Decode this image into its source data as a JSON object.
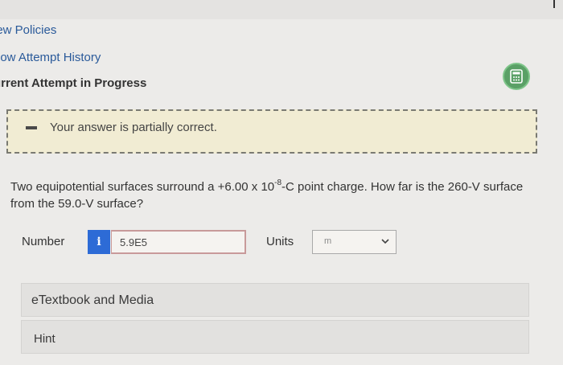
{
  "links": {
    "review_policies": "iew Policies",
    "attempt_history": "now Attempt History"
  },
  "attempt": {
    "title": "urrent Attempt in Progress"
  },
  "feedback": {
    "message": "Your answer is partially correct."
  },
  "question": {
    "text_before": "Two equipotential surfaces surround a +6.00 x 10",
    "exponent": "-8",
    "text_after": "-C point charge. How far is the 260-V surface from the 59.0-V surface?"
  },
  "answer": {
    "number_label": "Number",
    "info_glyph": "i",
    "value": "5.9E5",
    "units_label": "Units",
    "units_value": "m"
  },
  "panels": {
    "etextbook": "eTextbook and Media",
    "hint": "Hint"
  },
  "icons": {
    "status": "calculator-icon",
    "info": "info-icon",
    "dropdown": "chevron-down-icon"
  },
  "colors": {
    "link": "#2a5a9a",
    "status_green": "#5aa066",
    "banner_bg": "#f1ecd3",
    "info_blue": "#2d6bd6",
    "input_border": "#c89a9a"
  }
}
